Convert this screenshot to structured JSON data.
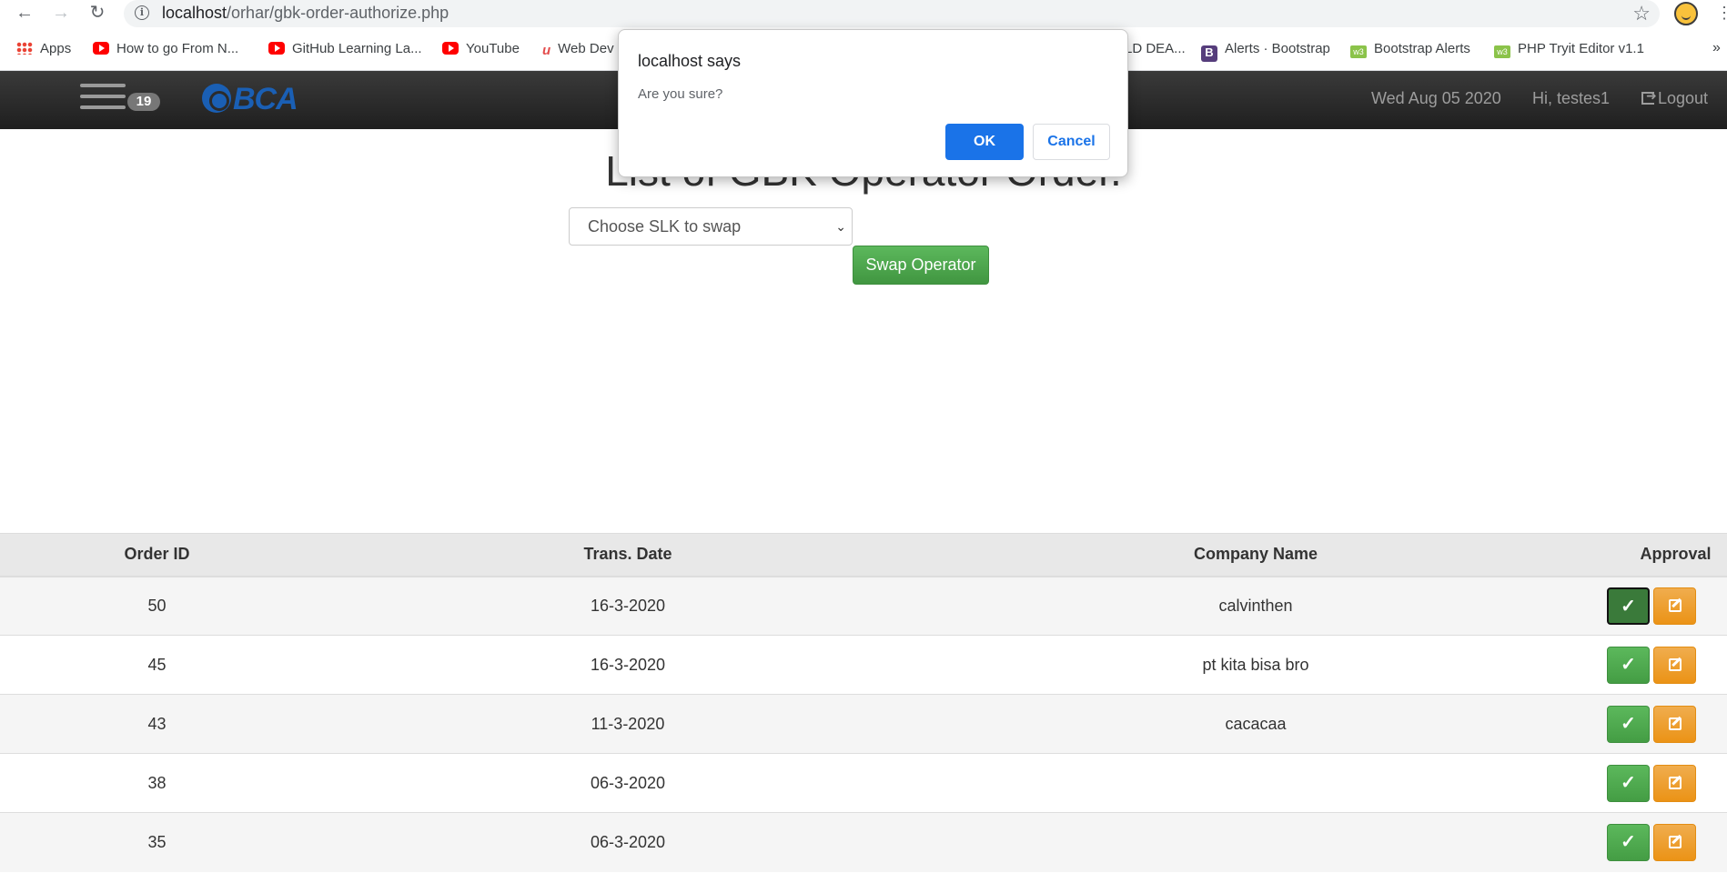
{
  "browser": {
    "url_host": "localhost",
    "url_path": "/orhar/gbk-order-authorize.php",
    "bookmarks": [
      {
        "label": "Apps",
        "icon": "apps-grid-icon"
      },
      {
        "label": "How to go From N...",
        "icon": "youtube-icon"
      },
      {
        "label": "GitHub Learning La...",
        "icon": "youtube-icon"
      },
      {
        "label": "YouTube",
        "icon": "youtube-icon"
      },
      {
        "label": "Web Dev",
        "icon": "webdev-icon"
      },
      {
        "label": "LD DEA...",
        "icon": "none"
      },
      {
        "label": "Alerts · Bootstrap",
        "icon": "bootstrap-icon"
      },
      {
        "label": "Bootstrap Alerts",
        "icon": "w3schools-icon"
      },
      {
        "label": "PHP Tryit Editor v1.1",
        "icon": "w3schools-icon"
      }
    ],
    "bookmarks_overflow": "»"
  },
  "navbar": {
    "badge_count": "19",
    "logo_text": "BCA",
    "date": "Wed Aug 05 2020",
    "greeting": "Hi, testes1",
    "logout_label": "Logout"
  },
  "main": {
    "title": "List of GBK Operator Order.",
    "select_placeholder": "Choose SLK to swap",
    "swap_button_label": "Swap Operator"
  },
  "table": {
    "headers": [
      "Order ID",
      "Trans. Date",
      "Company Name",
      "Approval"
    ],
    "rows": [
      {
        "order_id": "50",
        "date": "16-3-2020",
        "company": "calvinthen"
      },
      {
        "order_id": "45",
        "date": "16-3-2020",
        "company": "pt kita bisa bro"
      },
      {
        "order_id": "43",
        "date": "11-3-2020",
        "company": "cacacaa"
      },
      {
        "order_id": "38",
        "date": "06-3-2020",
        "company": ""
      },
      {
        "order_id": "35",
        "date": "06-3-2020",
        "company": ""
      }
    ],
    "approve_glyph": "✓"
  },
  "dialog": {
    "title": "localhost says",
    "message": "Are you sure?",
    "ok_label": "OK",
    "cancel_label": "Cancel"
  },
  "colors": {
    "navbar": "#2b2b2b",
    "brand": "#1a5fb4",
    "success": "#5cb85c",
    "warning": "#f0ad4e",
    "dialog_primary": "#1a73e8"
  }
}
